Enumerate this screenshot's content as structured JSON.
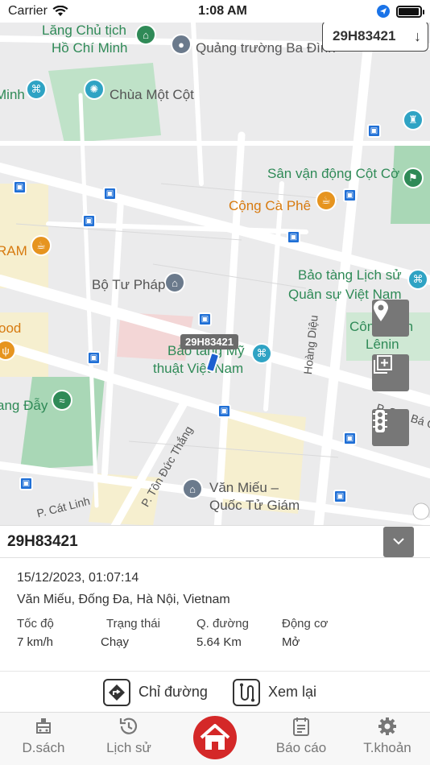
{
  "status": {
    "carrier": "Carrier",
    "time": "1:08 AM",
    "battery_level": 0.95
  },
  "plate_selector": {
    "value": "29H83421",
    "arrow": "↓"
  },
  "map": {
    "labels": {
      "lang_chu_tich": "Lăng Chủ tịch",
      "ho_chi_minh": "Hồ Chí Minh",
      "quang_truong": "Quảng trường Ba Đình",
      "chua_mot_cot": "Chùa Một Cột",
      "minh": "Minh",
      "san_van_dong": "Sân vận động Cột Cờ",
      "cong_ca_phe": "Cộng Cà Phê",
      "ram": "RAM",
      "bo_tu_phap": "Bộ Tư Pháp",
      "bao_tang_lich_su_1": "Bảo tàng Lịch sử",
      "bao_tang_lich_su_2": "Quân sự Việt Nam",
      "ood": "ood",
      "cong_vien": "Công Viên",
      "lenin": "Lênin",
      "bao_tang_my_thuat_1": "Bảo tàng Mỹ",
      "bao_tang_my_thuat_2": "thuật Việt Nam",
      "hoang_dieu": "Hoàng Diệu",
      "cao_ba_quat": "P. Cao Bá Quát",
      "ang_day": "ang Đẫy",
      "ton_duc_thang": "P. Tôn Đức Thắng",
      "van_mieu_1": "Văn Miếu –",
      "van_mieu_2": "Quốc Tử Giám",
      "cat_linh": "P. Cát Linh"
    },
    "vehicle_tag": "29H83421"
  },
  "info": {
    "plate": "29H83421",
    "timestamp": "15/12/2023, 01:07:14",
    "address": "Văn Miếu, Đống Đa, Hà Nội, Vietnam",
    "stats": [
      {
        "label": "Tốc độ",
        "value": "7 km/h"
      },
      {
        "label": "Trạng thái",
        "value": "Chạy"
      },
      {
        "label": "Q. đường",
        "value": "5.64 Km"
      },
      {
        "label": "Động cơ",
        "value": "Mở"
      }
    ],
    "actions": {
      "directions": "Chỉ đường",
      "replay": "Xem lại"
    }
  },
  "tabs": [
    {
      "label": "D.sách",
      "icon": "vehicle-list-icon"
    },
    {
      "label": "Lịch sử",
      "icon": "history-icon"
    },
    {
      "label": "",
      "icon": "home-icon"
    },
    {
      "label": "Báo cáo",
      "icon": "report-icon"
    },
    {
      "label": "T.khoản",
      "icon": "settings-icon"
    }
  ],
  "colors": {
    "accent": "#d42828",
    "road_bus": "#1f6fd6",
    "park": "#a9d7b6"
  }
}
